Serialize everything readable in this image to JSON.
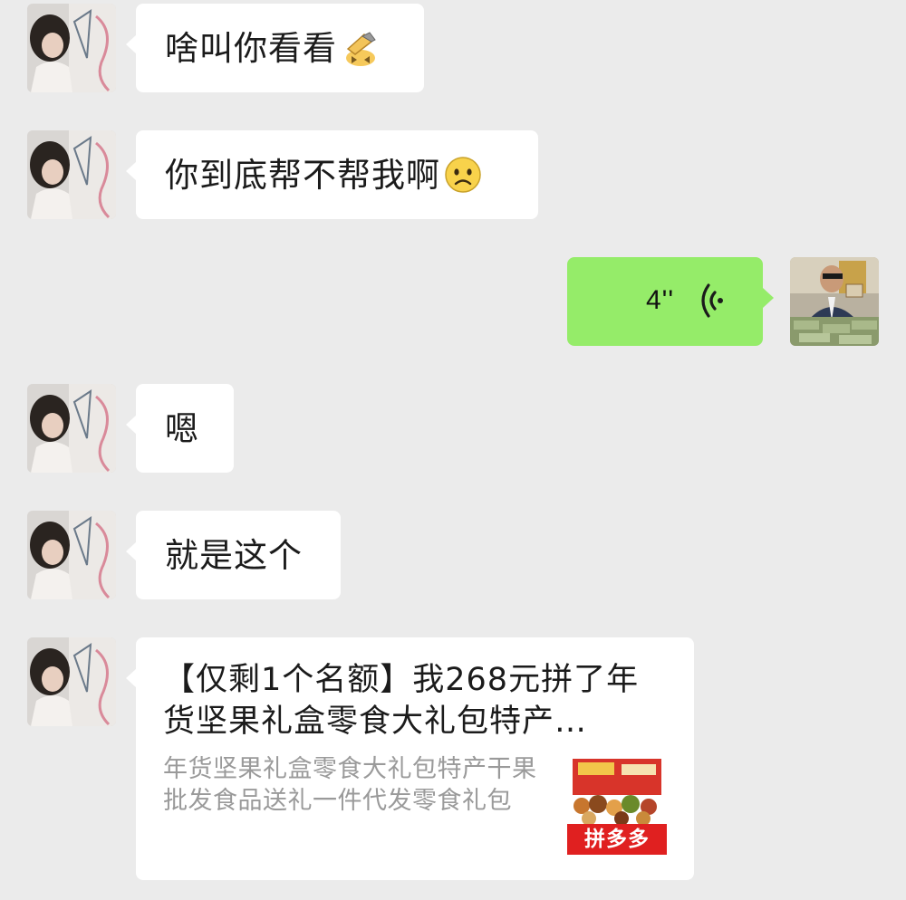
{
  "chat": {
    "messages": [
      {
        "direction": "incoming",
        "type": "text",
        "text": "啥叫你看看",
        "emoji": "facepalm-emoji"
      },
      {
        "direction": "incoming",
        "type": "text",
        "text": "你到底帮不帮我啊",
        "emoji": "sad-face-emoji"
      },
      {
        "direction": "outgoing",
        "type": "voice",
        "duration": "4''",
        "icon": "voice-wave-icon"
      },
      {
        "direction": "incoming",
        "type": "text",
        "text": "嗯"
      },
      {
        "direction": "incoming",
        "type": "text",
        "text": "就是这个"
      },
      {
        "direction": "incoming",
        "type": "link-card",
        "title": "【仅剩1个名额】我268元拼了年货坚果礼盒零食大礼包特产…",
        "description": "年货坚果礼盒零食大礼包特产干果批发食品送礼一件代发零食礼包",
        "thumbnail_brand": "拼多多"
      }
    ]
  },
  "colors": {
    "background": "#ebebeb",
    "incoming_bubble": "#ffffff",
    "outgoing_bubble": "#95ec69",
    "brand_red": "#e02020"
  }
}
